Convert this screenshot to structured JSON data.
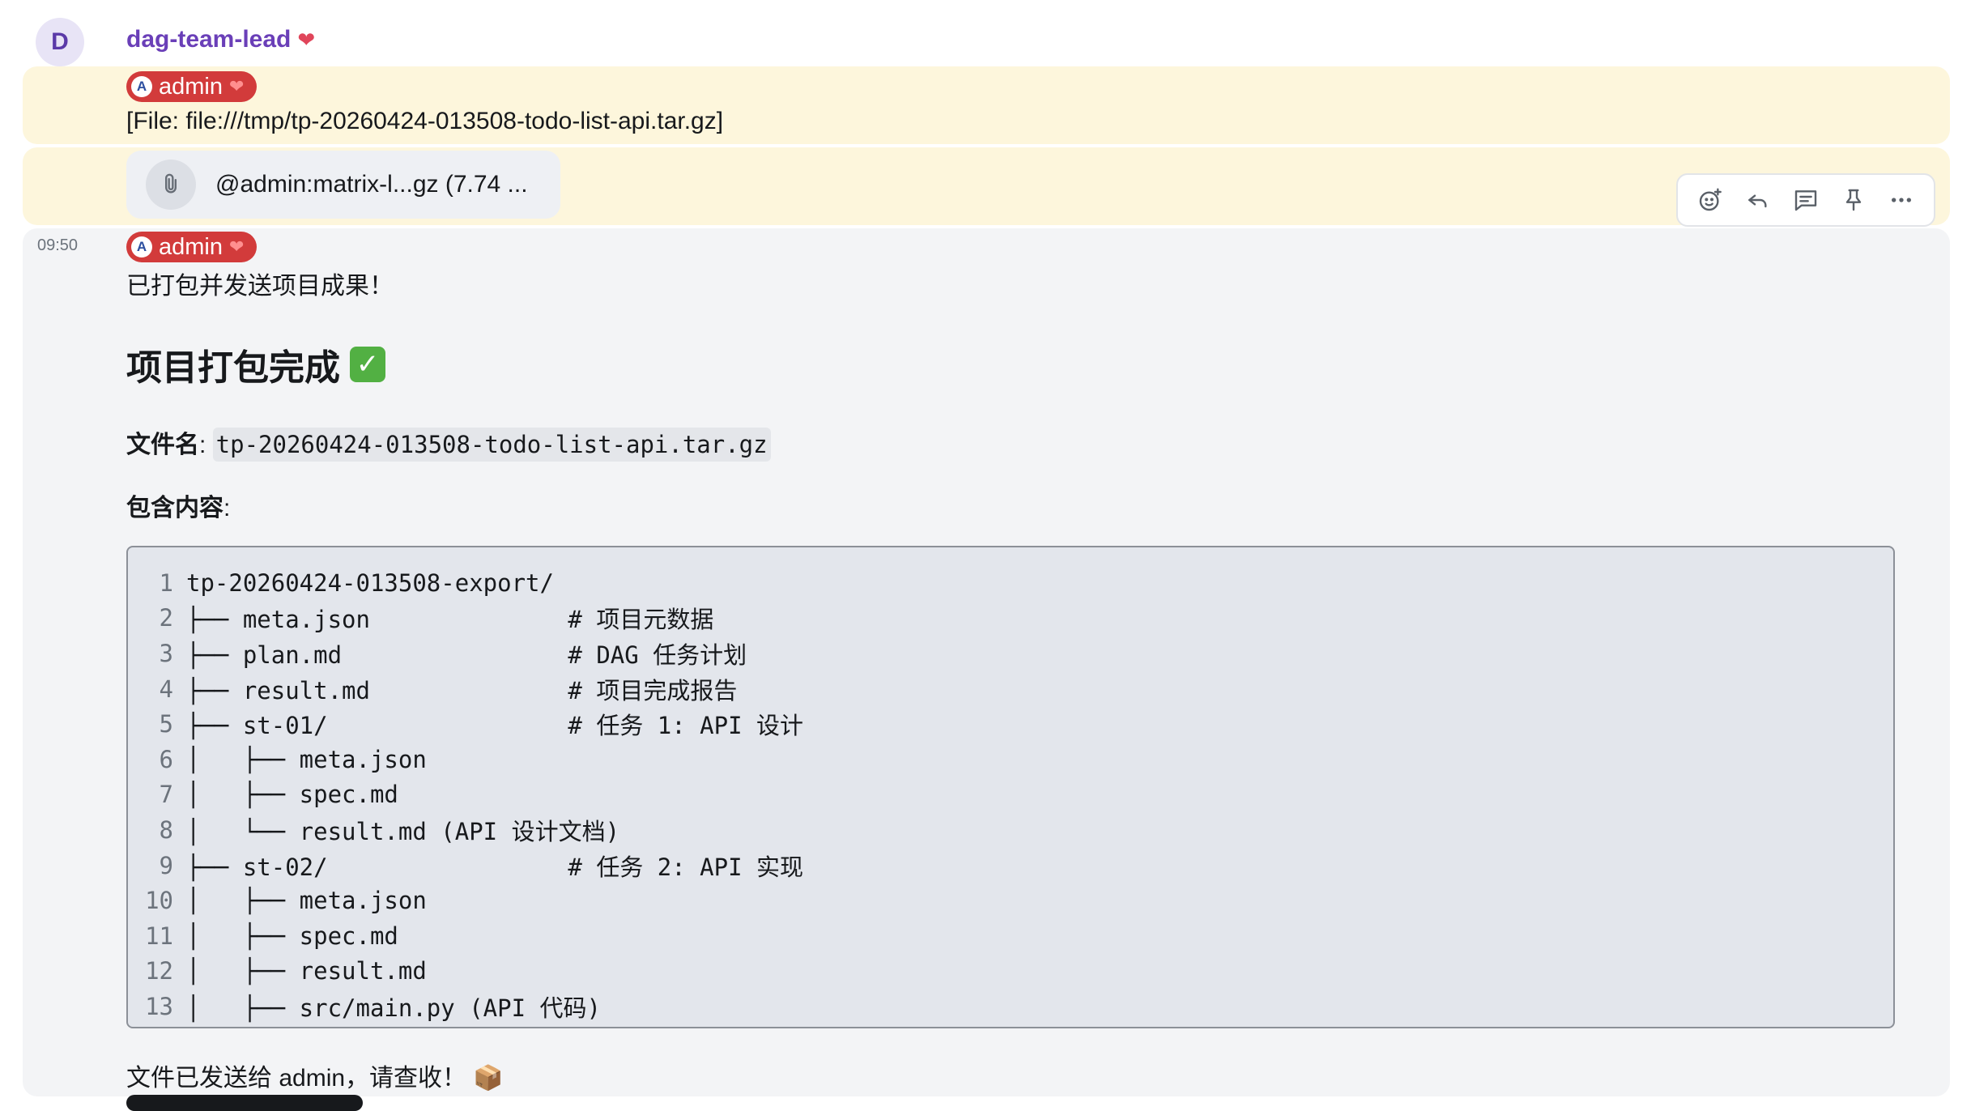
{
  "sender": {
    "avatar_letter": "D",
    "name": "dag-team-lead",
    "heart": "❤"
  },
  "message1": {
    "pill": {
      "letter": "A",
      "name": "admin",
      "heart": "❤"
    },
    "text": "[File: file:///tmp/tp-20260424-013508-todo-list-api.tar.gz]"
  },
  "message2": {
    "file_icon": "paperclip-icon",
    "file_label": "@admin:matrix-l...gz (7.74 ..."
  },
  "toolbar": {
    "icons": [
      "emoji-add-icon",
      "reply-icon",
      "thread-icon",
      "pin-icon",
      "more-icon"
    ]
  },
  "message3": {
    "timestamp": "09:50",
    "pill": {
      "letter": "A",
      "name": "admin",
      "heart": "❤"
    },
    "intro": "已打包并发送项目成果！",
    "heading": "项目打包完成",
    "heading_check": "✓",
    "filename_label": "文件名",
    "filename_sep": ": ",
    "filename_value": "tp-20260424-013508-todo-list-api.tar.gz",
    "contents_label": "包含内容",
    "contents_sep": ":",
    "code_lines": [
      {
        "n": "1",
        "code": "tp-20260424-013508-export/"
      },
      {
        "n": "2",
        "code": "├── meta.json              # 项目元数据"
      },
      {
        "n": "3",
        "code": "├── plan.md                # DAG 任务计划"
      },
      {
        "n": "4",
        "code": "├── result.md              # 项目完成报告"
      },
      {
        "n": "5",
        "code": "├── st-01/                 # 任务 1: API 设计"
      },
      {
        "n": "6",
        "code": "│   ├── meta.json"
      },
      {
        "n": "7",
        "code": "│   ├── spec.md"
      },
      {
        "n": "8",
        "code": "│   └── result.md (API 设计文档)"
      },
      {
        "n": "9",
        "code": "├── st-02/                 # 任务 2: API 实现"
      },
      {
        "n": "10",
        "code": "│   ├── meta.json"
      },
      {
        "n": "11",
        "code": "│   ├── spec.md"
      },
      {
        "n": "12",
        "code": "│   ├── result.md"
      },
      {
        "n": "13",
        "code": "│   ├── src/main.py (API 代码)"
      }
    ],
    "footer": "文件已发送给 admin，请查收！",
    "footer_emoji": "📦"
  }
}
